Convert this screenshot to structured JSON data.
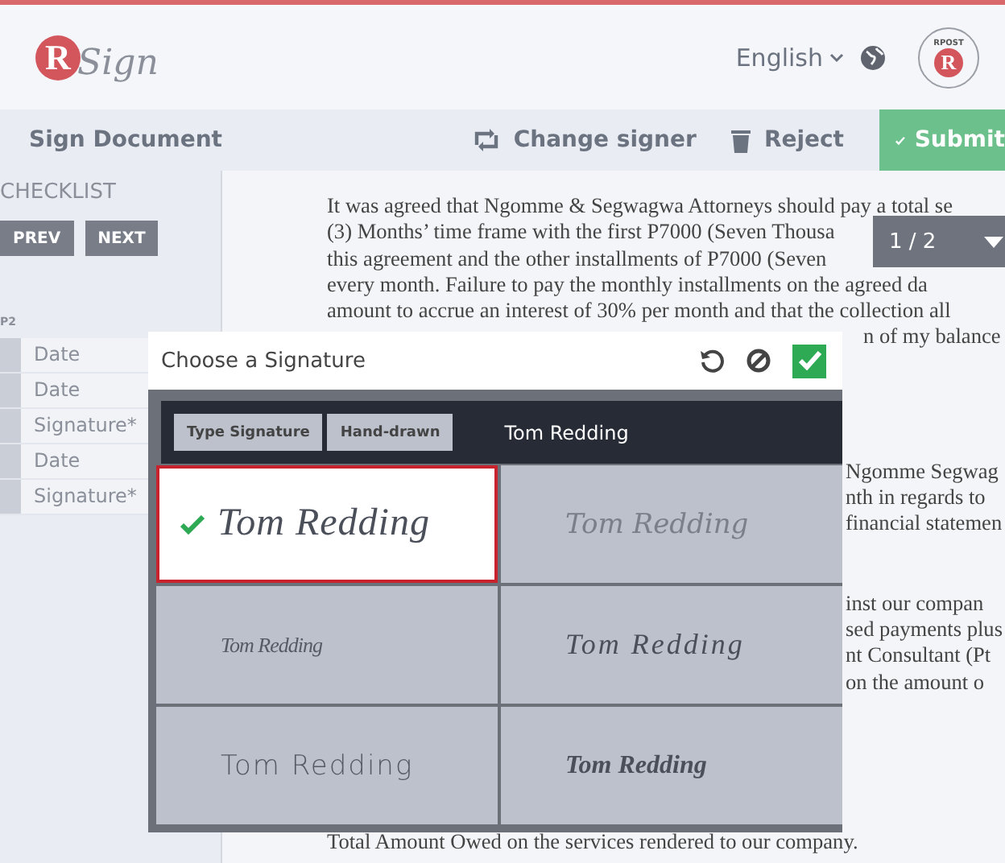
{
  "header": {
    "logo": {
      "letter": "R",
      "word": "Sign"
    },
    "language": "English",
    "badge": {
      "top": "RPOST",
      "letter": "R"
    }
  },
  "toolbar": {
    "title": "Sign Document",
    "actions": [
      {
        "kind": "change",
        "label": "Change signer"
      },
      {
        "kind": "reject",
        "label": "Reject"
      }
    ],
    "submit": "Submit"
  },
  "sidebar": {
    "title": "CHECKLIST",
    "buttons": [
      "PREV",
      "NEXT"
    ],
    "page_label": "P2",
    "fields": [
      "Date",
      "Date",
      "Signature*",
      "Date",
      "Signature*"
    ]
  },
  "document": {
    "page_indicator": "1 / 2",
    "paragraphs": [
      {
        "kind": "full",
        "lines": [
          "It was agreed that Ngomme & Segwagwa Attorneys should pay a total se",
          "(3) Months’ time frame with the first P7000 (Seven Thousa",
          "this agreement and the other installments of P7000 (Seven",
          "every month. Failure to pay the monthly installments on the agreed da",
          "amount to accrue an interest of 30% per month and that the collection all"
        ]
      },
      {
        "kind": "edge-far",
        "lines": [
          "n of my balance"
        ]
      },
      {
        "kind": "edge",
        "lines": [
          "Ngomme  Segwag",
          "nth in regards to",
          "financial statemen"
        ]
      },
      {
        "kind": "edge",
        "lines": [
          "inst our compan",
          "sed payments plus",
          "nt Consultant (Pt",
          "on the amount o"
        ]
      },
      {
        "kind": "full",
        "lines": [
          "Total Amount Owed on the services rendered to our company."
        ]
      }
    ]
  },
  "signature_dialog": {
    "title": "Choose a Signature",
    "modes": [
      "Type Signature",
      "Hand-drawn"
    ],
    "name_value": "Tom Redding",
    "signatures": [
      {
        "kind": "flourish",
        "text": "Tom Redding",
        "selected": true
      },
      {
        "kind": "light",
        "text": "Tom Redding",
        "selected": false
      },
      {
        "kind": "small",
        "text": "Tom Redding",
        "selected": false
      },
      {
        "kind": "cursive",
        "text": "Tom Redding",
        "selected": false
      },
      {
        "kind": "print",
        "text": "Tom Redding",
        "selected": false
      },
      {
        "kind": "bold",
        "text": "Tom Redding",
        "selected": false
      }
    ]
  }
}
